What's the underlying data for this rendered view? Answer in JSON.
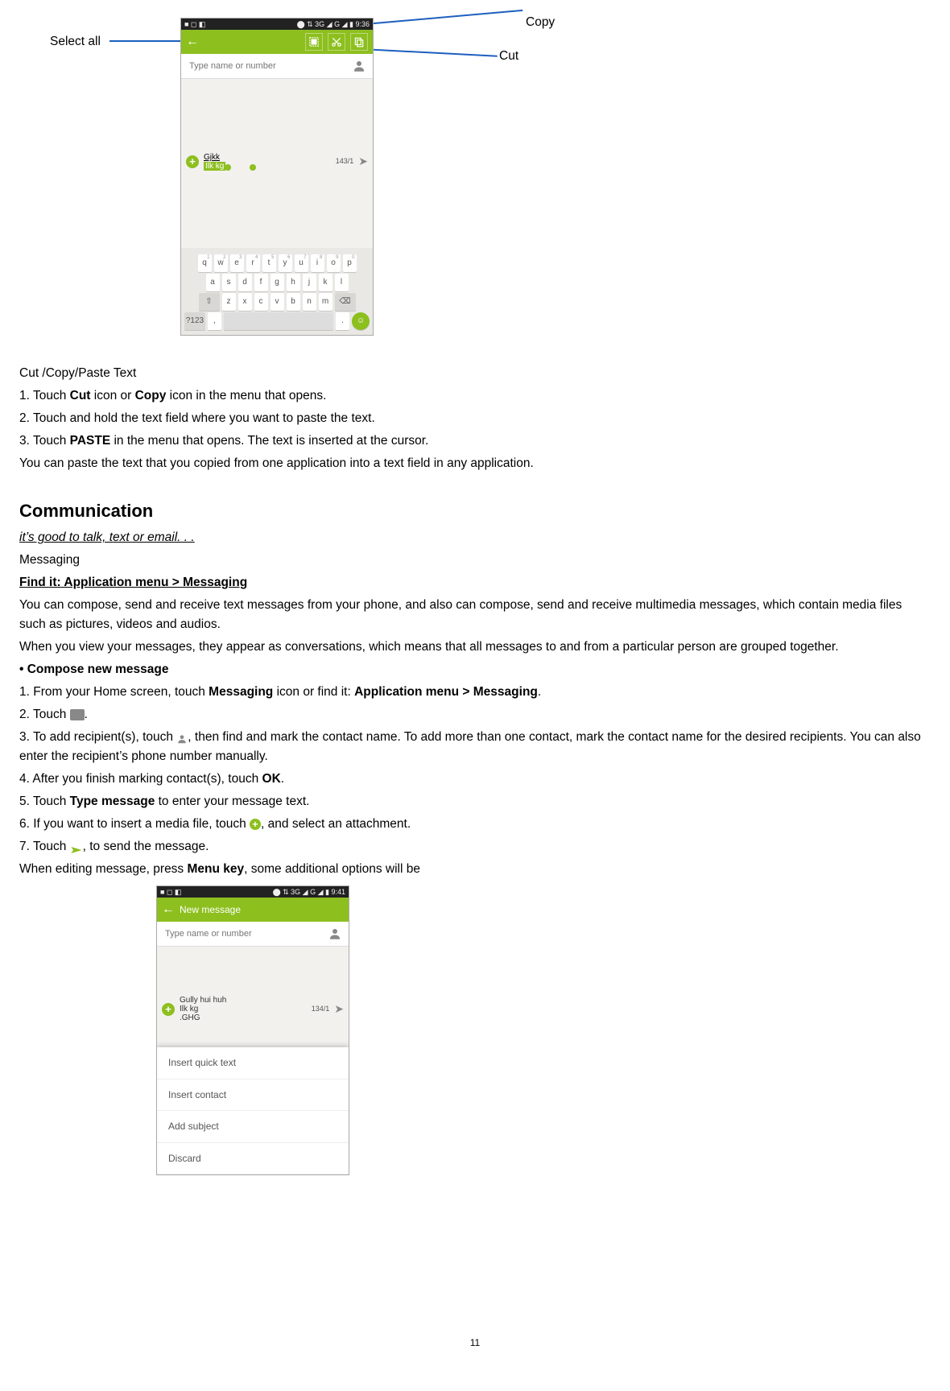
{
  "callouts": {
    "select_all": "Select all",
    "copy": "Copy",
    "cut": "Cut"
  },
  "phone1": {
    "status_left": "■ ◻ ◧",
    "status_right": "⬤ ⇅ 3G ◢ G ◢ ▮ 9:36",
    "recipient_placeholder": "Type name or number",
    "sel_line1": "Gjkk",
    "sel_line2_hl": "Ilk kg",
    "char_count": "143/1",
    "kbd_row1": [
      "q",
      "w",
      "e",
      "r",
      "t",
      "y",
      "u",
      "i",
      "o",
      "p"
    ],
    "kbd_row1_nums": [
      "1",
      "2",
      "3",
      "4",
      "5",
      "6",
      "7",
      "8",
      "9",
      "0"
    ],
    "kbd_row2": [
      "a",
      "s",
      "d",
      "f",
      "g",
      "h",
      "j",
      "k",
      "l"
    ],
    "kbd_row3": [
      "z",
      "x",
      "c",
      "v",
      "b",
      "n",
      "m"
    ],
    "kbd_shift": "⇧",
    "kbd_bksp": "⌫",
    "kbd_sym": "?123",
    "kbd_comma": ",",
    "kbd_period": ".",
    "kbd_emoji": "☺"
  },
  "section_cut": {
    "title": "Cut /Copy/Paste Text",
    "s1a": "1. Touch ",
    "s1b": "Cut",
    "s1c": " icon or ",
    "s1d": "Copy",
    "s1e": " icon in the menu that opens.",
    "s2": "2. Touch and hold the text field where you want to paste the text.",
    "s3a": "3. Touch ",
    "s3b": "PASTE",
    "s3c": " in the menu that opens. The text is inserted at the cursor.",
    "s4": "You can paste the text that you copied from one application into a text field in any application."
  },
  "comm": {
    "heading": "Communication",
    "tagline": "it’s good to talk, text or email. . .",
    "messaging": "Messaging",
    "find_it": "Find it: Application menu > Messaging",
    "p1": "You can compose, send and receive text messages from your phone, and also can compose, send and receive multimedia messages, which contain media files such as pictures, videos and audios.",
    "p2": "When you view your messages, they appear as conversations, which means that all messages to and from a particular person are grouped together.",
    "compose_title": "• Compose new message",
    "c1a": "1. From your Home screen, touch ",
    "c1b": "Messaging",
    "c1c": " icon or find it: ",
    "c1d": "Application menu > Messaging",
    "c1e": ".",
    "c2a": "2. Touch ",
    "c2b": ".",
    "c3a": "3. To add recipient(s), touch ",
    "c3b": ", then find and mark the contact name. To add more than one contact, mark the contact name for the desired recipients. You can also enter the recipient’s phone number manually.",
    "c4a": "4. After you finish marking contact(s), touch ",
    "c4b": "OK",
    "c4c": ".",
    "c5a": "5. Touch ",
    "c5b": "Type message",
    "c5c": " to enter your message text.",
    "c6a": "6. If you want to insert a media file, touch ",
    "c6b": ", and select an attachment.",
    "c7a": "7. Touch ",
    "c7b": ", to send the message.",
    "c8a": "When editing message, press ",
    "c8b": "Menu key",
    "c8c": ", some additional options will be"
  },
  "phone2": {
    "status_left": "■ ◻ ◧",
    "status_right": "⬤ ⇅ 3G ◢ G ◢ ▮ 9:41",
    "title": "New message",
    "recipient_placeholder": "Type name or number",
    "msg_line1": "Gully hui huh",
    "msg_line2": "Ilk kg",
    "msg_line3": ".GHG",
    "char_count": "134/1",
    "menu": [
      "Insert quick text",
      "Insert contact",
      "Add subject",
      "Discard"
    ]
  },
  "page_number": "11"
}
